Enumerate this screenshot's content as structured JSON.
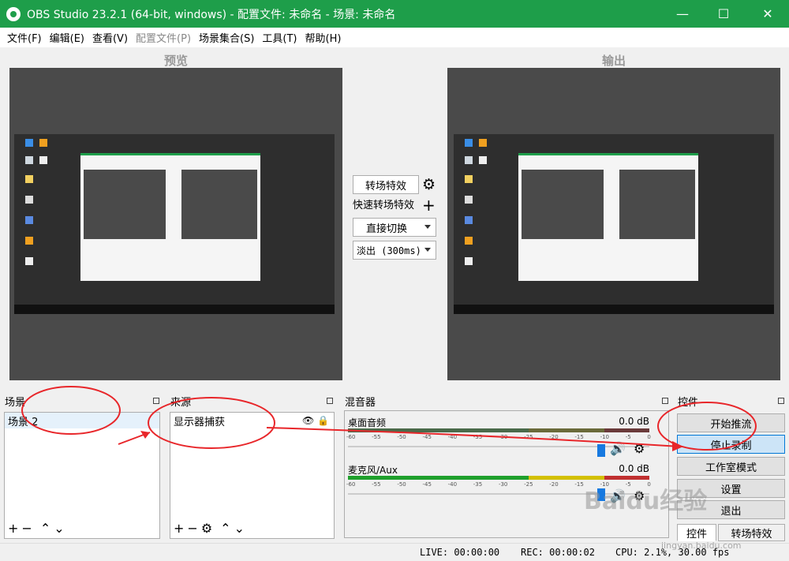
{
  "titlebar": {
    "title": "OBS Studio 23.2.1 (64-bit, windows) - 配置文件: 未命名 - 场景: 未命名",
    "minimize": "—",
    "maximize": "☐",
    "close": "✕"
  },
  "menu": {
    "items": [
      {
        "label": "文件(F)",
        "enabled": true
      },
      {
        "label": "编辑(E)",
        "enabled": true
      },
      {
        "label": "查看(V)",
        "enabled": true
      },
      {
        "label": "配置文件(P)",
        "enabled": false
      },
      {
        "label": "场景集合(S)",
        "enabled": true
      },
      {
        "label": "工具(T)",
        "enabled": true
      },
      {
        "label": "帮助(H)",
        "enabled": true
      }
    ]
  },
  "preview": {
    "label": "预览"
  },
  "output": {
    "label": "输出"
  },
  "transition": {
    "effects_button": "转场特效",
    "quick_label": "快速转场特效",
    "cut_option": "直接切换",
    "fade_option": "淡出 (300ms)"
  },
  "scenes": {
    "header": "场景",
    "items": [
      "场景 2"
    ]
  },
  "sources": {
    "header": "来源",
    "items": [
      "显示器捕获"
    ]
  },
  "mixer": {
    "header": "混音器",
    "channels": [
      {
        "name": "桌面音频",
        "db": "0.0 dB",
        "fader_level": 1.0
      },
      {
        "name": "麦克风/Aux",
        "db": "0.0 dB",
        "fader_level": 1.0
      }
    ],
    "ticks": [
      "-60",
      "-55",
      "-50",
      "-45",
      "-40",
      "-35",
      "-30",
      "-25",
      "-20",
      "-15",
      "-10",
      "-5",
      "0"
    ]
  },
  "controls": {
    "header": "控件",
    "start_stream": "开始推流",
    "stop_record": "停止录制",
    "studio_mode": "工作室模式",
    "settings": "设置",
    "exit": "退出",
    "tab_controls": "控件",
    "tab_transitions": "转场特效"
  },
  "status": {
    "live": "LIVE: 00:00:00",
    "rec": "REC: 00:00:02",
    "cpu": "CPU: 2.1%, 30.00 fps"
  },
  "watermark": {
    "text": "Baidu经验",
    "url": "jingyan.baidu.com"
  },
  "colors": {
    "titlebar": "#1e9e4a",
    "annotation": "#e8262a",
    "canvas": "#4a4a4a"
  }
}
